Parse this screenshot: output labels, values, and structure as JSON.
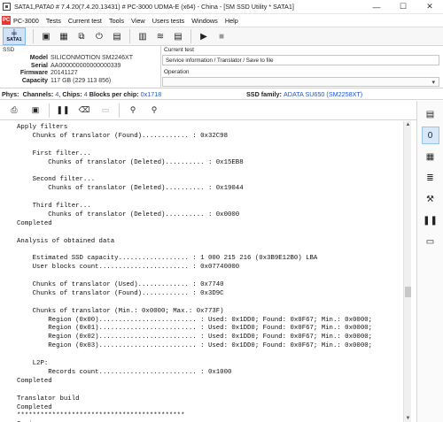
{
  "window": {
    "title": "SATA1,PATA0 # 7.4.20(7.4.20.13431) # PC-3000 UDMA-E (x64) - China - [SM SSD Utility * SATA1]",
    "controls": [
      "—",
      "☐",
      "✕"
    ]
  },
  "menu": {
    "logo": "PC",
    "items": [
      "PC-3000",
      "Tests",
      "Current test",
      "Tools",
      "View",
      "Users tests",
      "Windows",
      "Help"
    ]
  },
  "toolbar": {
    "selected_label": "SATA1"
  },
  "ssd": {
    "header": "SSD",
    "labels": [
      "Model",
      "Serial",
      "Firmware",
      "Capacity"
    ],
    "model": "SILICONMOTION SM2246XT",
    "serial": "AA000000000000000339",
    "firmware": "20141127",
    "capacity": "117 GB (229 113 856)"
  },
  "current_test": {
    "label": "Current test",
    "value": "Service information / Translator / Save to file"
  },
  "operation": {
    "label": "Operation"
  },
  "phys": {
    "label": "Phys:",
    "channels_label": "Channels:",
    "channels": "4",
    "chips_label": "Chips:",
    "chips": "4",
    "blocks_label": "Blocks per chip:",
    "blocks": "0x1718",
    "family_label": "SSD family:",
    "family": "ADATA SU650 (SM2258XT)"
  },
  "log": {
    "lines": [
      "Apply filters",
      "    Chunks of translator (Found)............ : 0x32C98",
      "",
      "    First filter...",
      "        Chunks of translator (Deleted).......... : 0x15EB8",
      "",
      "    Second filter...",
      "        Chunks of translator (Deleted).......... : 0x19044",
      "",
      "    Third filter...",
      "        Chunks of translator (Deleted).......... : 0x0000",
      "Completed",
      "",
      "Analysis of obtained data",
      "",
      "    Estimated SSD capacity.................. : 1 000 215 216 (0x3B9E12B0) LBA",
      "    User blocks count....................... : 0x07740000",
      "",
      "    Chunks of translator (Used)............. : 0x7740",
      "    Chunks of translator (Found)............ : 0x3D9C",
      "",
      "    Chunks of translator (Min.: 0x0000; Max.: 0x773F)",
      "        Region (0x00)......................... : Used: 0x1DD0; Found: 0x0F67; Min.: 0x0000;",
      "        Region (0x01)......................... : Used: 0x1DD0; Found: 0x0F67; Min.: 0x0000;",
      "        Region (0x02)......................... : Used: 0x1DD0; Found: 0x0F67; Min.: 0x0000;",
      "        Region (0x03)......................... : Used: 0x1DD0; Found: 0x0F67; Min.: 0x0000;",
      "",
      "    L2P:",
      "        Records count......................... : 0x1000",
      "Completed",
      "",
      "Translator build",
      "Completed",
      "*******************************************",
      "Saving..."
    ]
  }
}
